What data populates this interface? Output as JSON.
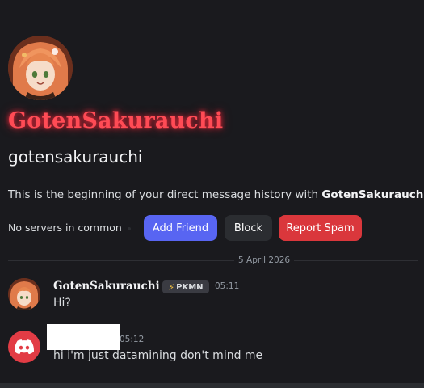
{
  "profile": {
    "display_name": "GotenSakurauchi",
    "username": "gotensakurauchi",
    "intro_prefix": "This is the beginning of your direct message history with ",
    "intro_name": "GotenSakurauchi",
    "intro_suffix": "."
  },
  "actions": {
    "servers_text": "No servers in common",
    "add_friend_label": "Add Friend",
    "block_label": "Block",
    "report_spam_label": "Report Spam"
  },
  "divider": {
    "date": "5 April 2026"
  },
  "messages": [
    {
      "author": "GotenSakurauchi",
      "tag": "PKMN",
      "time": "05:11",
      "text": "Hi?"
    },
    {
      "author": "",
      "time": "05:12",
      "text": "hi i'm just datamining don't mind me"
    }
  ],
  "colors": {
    "background": "#1a1a1e",
    "display_name_glow": "#ff4b55",
    "add_friend": "#5865f2",
    "block": "#2b2d31",
    "report_spam": "#da373c",
    "discord_avatar": "#e23c45"
  }
}
